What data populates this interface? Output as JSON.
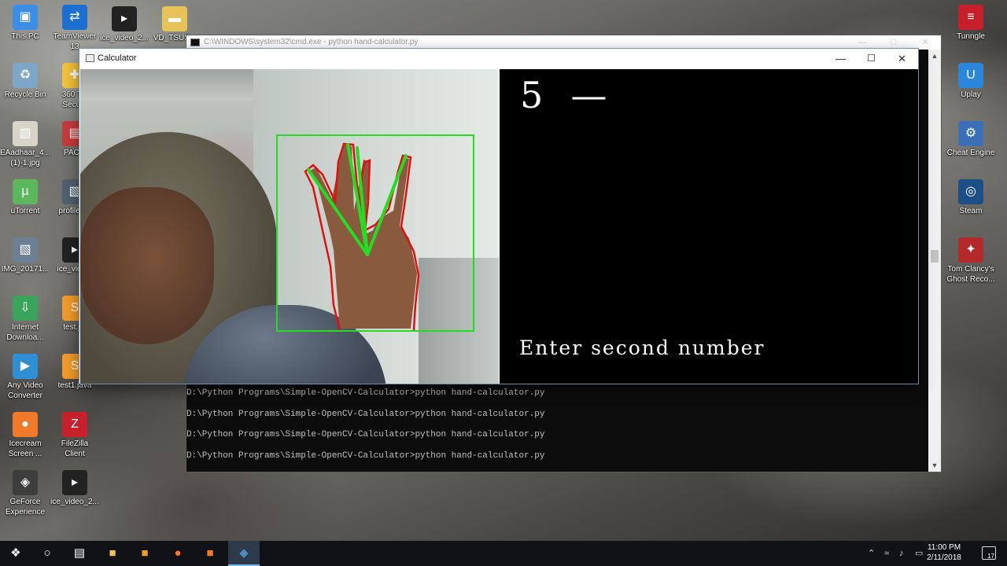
{
  "desktop": {
    "left_icons": [
      {
        "label": "This PC",
        "icon": "computer-icon",
        "color": "#3a8ee6"
      },
      {
        "label": "Recycle Bin",
        "icon": "recycle-bin-icon",
        "color": "#7da7c9"
      },
      {
        "label": "EAadhaar_4...\n(1)-1.jpg",
        "icon": "image-file-icon",
        "color": "#d9d4c7"
      },
      {
        "label": "uTorrent",
        "icon": "utorrent-icon",
        "color": "#5cb85c"
      },
      {
        "label": "IMG_20171...",
        "icon": "image-file-icon",
        "color": "#6b7f95"
      },
      {
        "label": "Internet\nDownloa...",
        "icon": "download-manager-icon",
        "color": "#3aa55a"
      },
      {
        "label": "Any Video\nConverter",
        "icon": "video-converter-icon",
        "color": "#2f8fd4"
      },
      {
        "label": "Icecream\nScreen ...",
        "icon": "icecream-recorder-icon",
        "color": "#f07a2a"
      },
      {
        "label": "GeForce\nExperience",
        "icon": "geforce-icon",
        "color": "#3d3d3d"
      }
    ],
    "second_column_icons": [
      {
        "label": "TeamViewer\n13",
        "icon": "teamviewer-icon",
        "color": "#1b6fd1"
      },
      {
        "label": "360 T...\nSecu...",
        "icon": "security-icon",
        "color": "#f2c23a"
      },
      {
        "label": "PAC...",
        "icon": "archive-icon",
        "color": "#c63b3b"
      },
      {
        "label": "profilep...",
        "icon": "image-file-icon",
        "color": "#506070"
      },
      {
        "label": "ice_vide...",
        "icon": "video-file-icon",
        "color": "#222222"
      },
      {
        "label": "test.j...",
        "icon": "sublime-file-icon",
        "color": "#f29b2a"
      },
      {
        "label": "test1.java",
        "icon": "sublime-file-icon",
        "color": "#f29b2a"
      },
      {
        "label": "FileZilla\nClient",
        "icon": "filezilla-icon",
        "color": "#c8202a"
      },
      {
        "label": "ice_video_2...",
        "icon": "video-file-icon",
        "color": "#222222"
      }
    ],
    "top_icons": [
      {
        "label": "ice_video_2...",
        "icon": "video-file-icon",
        "color": "#222222"
      },
      {
        "label": "VD_TSUS...",
        "icon": "folder-icon",
        "color": "#e8c35a"
      }
    ],
    "right_icons": [
      {
        "label": "Tunngle",
        "icon": "tunngle-icon",
        "color": "#c8202a"
      },
      {
        "label": "Uplay",
        "icon": "uplay-icon",
        "color": "#2a86d9"
      },
      {
        "label": "Cheat Engine",
        "icon": "cheat-engine-icon",
        "color": "#3b6fb6"
      },
      {
        "label": "Steam",
        "icon": "steam-icon",
        "color": "#1b4f86"
      },
      {
        "label": "Tom Clancy's\nGhost Reco...",
        "icon": "game-icon",
        "color": "#b42a2a"
      }
    ]
  },
  "cmd_window": {
    "title": "C:\\WINDOWS\\system32\\cmd.exe - python  hand-calculator.py",
    "lines": [
      "D:\\Python Programs\\Simple-OpenCV-Calculator>python hand-calculator.py",
      "D:\\Python Programs\\Simple-OpenCV-Calculator>python hand-calculator.py",
      "D:\\Python Programs\\Simple-OpenCV-Calculator>python hand-calculator.py",
      "D:\\Python Programs\\Simple-OpenCV-Calculator>python hand-calculator.py"
    ]
  },
  "calc_window": {
    "title": "Calculator",
    "expression": "5  —",
    "prompt": "Enter second number",
    "roi_color": "#22dd22",
    "contour_color": "#dd1111"
  },
  "taskbar": {
    "time": "11:00 PM",
    "date": "2/11/2018",
    "notification_count": "17",
    "accent": "#76b9ed"
  }
}
